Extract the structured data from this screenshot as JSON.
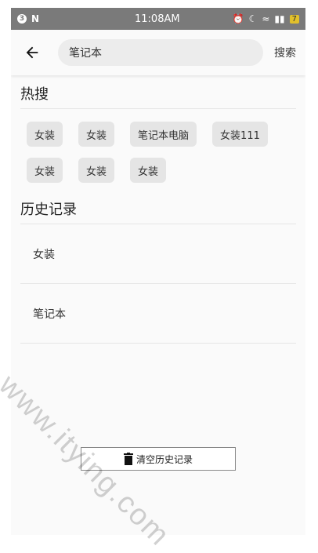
{
  "status_bar": {
    "time": "11:08AM",
    "battery": "7"
  },
  "search": {
    "value": "笔记本",
    "button_label": "搜索"
  },
  "hot_search": {
    "title": "热搜",
    "tags": [
      "女装",
      "女装",
      "笔记本电脑",
      "女装111",
      "女装",
      "女装",
      "女装"
    ]
  },
  "history": {
    "title": "历史记录",
    "items": [
      "女装",
      "笔记本"
    ],
    "clear_label": "清空历史记录"
  },
  "watermark": "www.itying.com",
  "icons": {
    "back": "back-arrow-icon",
    "trash": "trash-icon"
  }
}
